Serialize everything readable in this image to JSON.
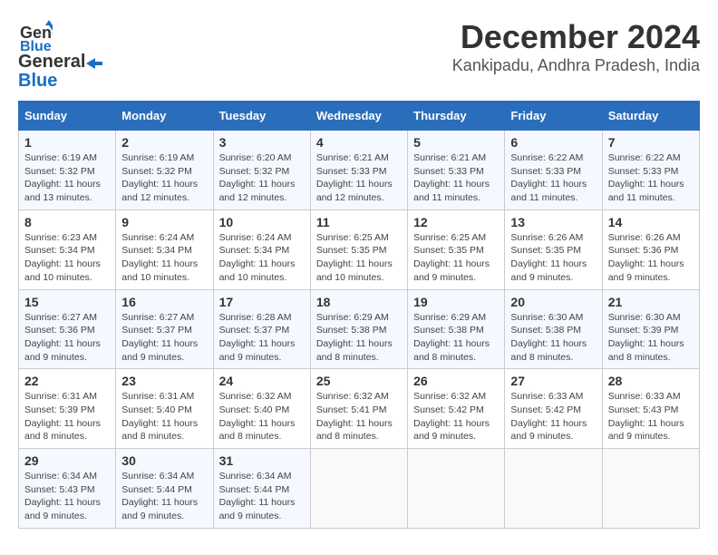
{
  "header": {
    "logo_line1": "General",
    "logo_line2": "Blue",
    "month": "December 2024",
    "location": "Kankipadu, Andhra Pradesh, India"
  },
  "weekdays": [
    "Sunday",
    "Monday",
    "Tuesday",
    "Wednesday",
    "Thursday",
    "Friday",
    "Saturday"
  ],
  "weeks": [
    [
      {
        "day": "1",
        "sunrise": "Sunrise: 6:19 AM",
        "sunset": "Sunset: 5:32 PM",
        "daylight": "Daylight: 11 hours and 13 minutes."
      },
      {
        "day": "2",
        "sunrise": "Sunrise: 6:19 AM",
        "sunset": "Sunset: 5:32 PM",
        "daylight": "Daylight: 11 hours and 12 minutes."
      },
      {
        "day": "3",
        "sunrise": "Sunrise: 6:20 AM",
        "sunset": "Sunset: 5:32 PM",
        "daylight": "Daylight: 11 hours and 12 minutes."
      },
      {
        "day": "4",
        "sunrise": "Sunrise: 6:21 AM",
        "sunset": "Sunset: 5:33 PM",
        "daylight": "Daylight: 11 hours and 12 minutes."
      },
      {
        "day": "5",
        "sunrise": "Sunrise: 6:21 AM",
        "sunset": "Sunset: 5:33 PM",
        "daylight": "Daylight: 11 hours and 11 minutes."
      },
      {
        "day": "6",
        "sunrise": "Sunrise: 6:22 AM",
        "sunset": "Sunset: 5:33 PM",
        "daylight": "Daylight: 11 hours and 11 minutes."
      },
      {
        "day": "7",
        "sunrise": "Sunrise: 6:22 AM",
        "sunset": "Sunset: 5:33 PM",
        "daylight": "Daylight: 11 hours and 11 minutes."
      }
    ],
    [
      {
        "day": "8",
        "sunrise": "Sunrise: 6:23 AM",
        "sunset": "Sunset: 5:34 PM",
        "daylight": "Daylight: 11 hours and 10 minutes."
      },
      {
        "day": "9",
        "sunrise": "Sunrise: 6:24 AM",
        "sunset": "Sunset: 5:34 PM",
        "daylight": "Daylight: 11 hours and 10 minutes."
      },
      {
        "day": "10",
        "sunrise": "Sunrise: 6:24 AM",
        "sunset": "Sunset: 5:34 PM",
        "daylight": "Daylight: 11 hours and 10 minutes."
      },
      {
        "day": "11",
        "sunrise": "Sunrise: 6:25 AM",
        "sunset": "Sunset: 5:35 PM",
        "daylight": "Daylight: 11 hours and 10 minutes."
      },
      {
        "day": "12",
        "sunrise": "Sunrise: 6:25 AM",
        "sunset": "Sunset: 5:35 PM",
        "daylight": "Daylight: 11 hours and 9 minutes."
      },
      {
        "day": "13",
        "sunrise": "Sunrise: 6:26 AM",
        "sunset": "Sunset: 5:35 PM",
        "daylight": "Daylight: 11 hours and 9 minutes."
      },
      {
        "day": "14",
        "sunrise": "Sunrise: 6:26 AM",
        "sunset": "Sunset: 5:36 PM",
        "daylight": "Daylight: 11 hours and 9 minutes."
      }
    ],
    [
      {
        "day": "15",
        "sunrise": "Sunrise: 6:27 AM",
        "sunset": "Sunset: 5:36 PM",
        "daylight": "Daylight: 11 hours and 9 minutes."
      },
      {
        "day": "16",
        "sunrise": "Sunrise: 6:27 AM",
        "sunset": "Sunset: 5:37 PM",
        "daylight": "Daylight: 11 hours and 9 minutes."
      },
      {
        "day": "17",
        "sunrise": "Sunrise: 6:28 AM",
        "sunset": "Sunset: 5:37 PM",
        "daylight": "Daylight: 11 hours and 9 minutes."
      },
      {
        "day": "18",
        "sunrise": "Sunrise: 6:29 AM",
        "sunset": "Sunset: 5:38 PM",
        "daylight": "Daylight: 11 hours and 8 minutes."
      },
      {
        "day": "19",
        "sunrise": "Sunrise: 6:29 AM",
        "sunset": "Sunset: 5:38 PM",
        "daylight": "Daylight: 11 hours and 8 minutes."
      },
      {
        "day": "20",
        "sunrise": "Sunrise: 6:30 AM",
        "sunset": "Sunset: 5:38 PM",
        "daylight": "Daylight: 11 hours and 8 minutes."
      },
      {
        "day": "21",
        "sunrise": "Sunrise: 6:30 AM",
        "sunset": "Sunset: 5:39 PM",
        "daylight": "Daylight: 11 hours and 8 minutes."
      }
    ],
    [
      {
        "day": "22",
        "sunrise": "Sunrise: 6:31 AM",
        "sunset": "Sunset: 5:39 PM",
        "daylight": "Daylight: 11 hours and 8 minutes."
      },
      {
        "day": "23",
        "sunrise": "Sunrise: 6:31 AM",
        "sunset": "Sunset: 5:40 PM",
        "daylight": "Daylight: 11 hours and 8 minutes."
      },
      {
        "day": "24",
        "sunrise": "Sunrise: 6:32 AM",
        "sunset": "Sunset: 5:40 PM",
        "daylight": "Daylight: 11 hours and 8 minutes."
      },
      {
        "day": "25",
        "sunrise": "Sunrise: 6:32 AM",
        "sunset": "Sunset: 5:41 PM",
        "daylight": "Daylight: 11 hours and 8 minutes."
      },
      {
        "day": "26",
        "sunrise": "Sunrise: 6:32 AM",
        "sunset": "Sunset: 5:42 PM",
        "daylight": "Daylight: 11 hours and 9 minutes."
      },
      {
        "day": "27",
        "sunrise": "Sunrise: 6:33 AM",
        "sunset": "Sunset: 5:42 PM",
        "daylight": "Daylight: 11 hours and 9 minutes."
      },
      {
        "day": "28",
        "sunrise": "Sunrise: 6:33 AM",
        "sunset": "Sunset: 5:43 PM",
        "daylight": "Daylight: 11 hours and 9 minutes."
      }
    ],
    [
      {
        "day": "29",
        "sunrise": "Sunrise: 6:34 AM",
        "sunset": "Sunset: 5:43 PM",
        "daylight": "Daylight: 11 hours and 9 minutes."
      },
      {
        "day": "30",
        "sunrise": "Sunrise: 6:34 AM",
        "sunset": "Sunset: 5:44 PM",
        "daylight": "Daylight: 11 hours and 9 minutes."
      },
      {
        "day": "31",
        "sunrise": "Sunrise: 6:34 AM",
        "sunset": "Sunset: 5:44 PM",
        "daylight": "Daylight: 11 hours and 9 minutes."
      },
      null,
      null,
      null,
      null
    ]
  ]
}
